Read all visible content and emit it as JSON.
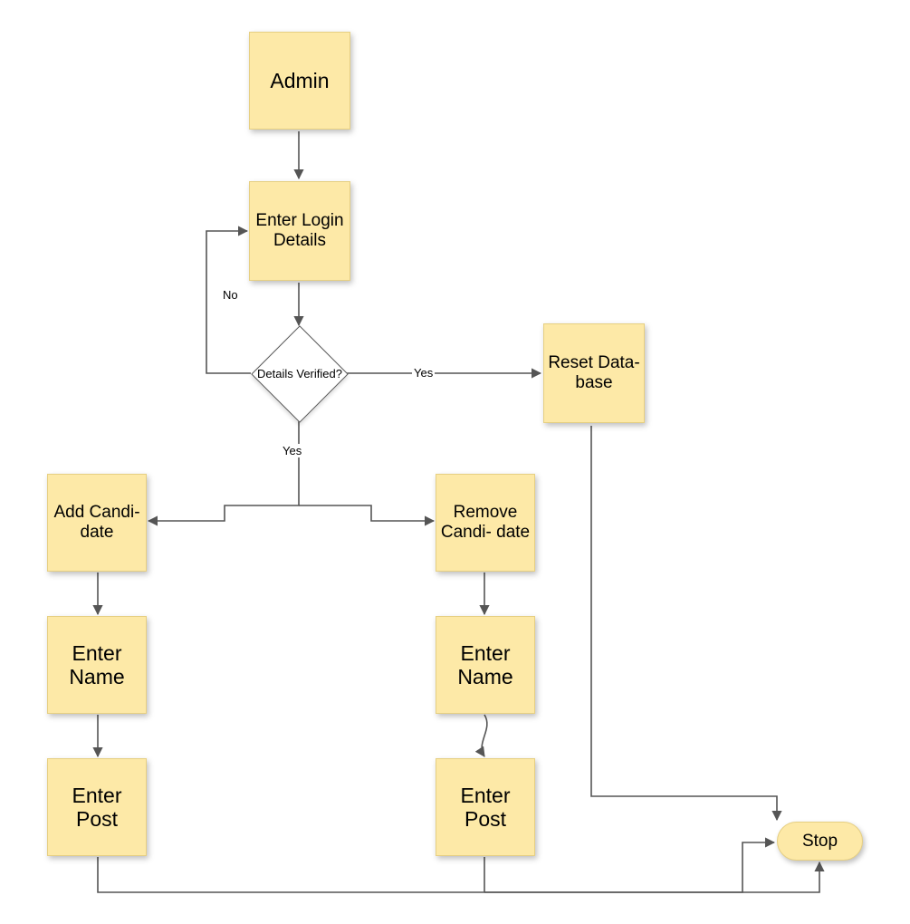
{
  "nodes": {
    "admin": "Admin",
    "enter_login": "Enter Login Details",
    "decision": "Details Verified?",
    "reset_db": "Reset Data-\nbase",
    "add_cand": "Add Candi-\ndate",
    "remove_cand": "Remove Candi-\ndate",
    "enter_name_left": "Enter Name",
    "enter_name_right": "Enter Name",
    "enter_post_left": "Enter Post",
    "enter_post_right": "Enter Post",
    "stop": "Stop"
  },
  "edges": {
    "no": "No",
    "yes_right": "Yes",
    "yes_down": "Yes"
  },
  "colors": {
    "node_fill": "#fde9a7",
    "node_border": "#e6cf82",
    "arrow": "#555555"
  }
}
